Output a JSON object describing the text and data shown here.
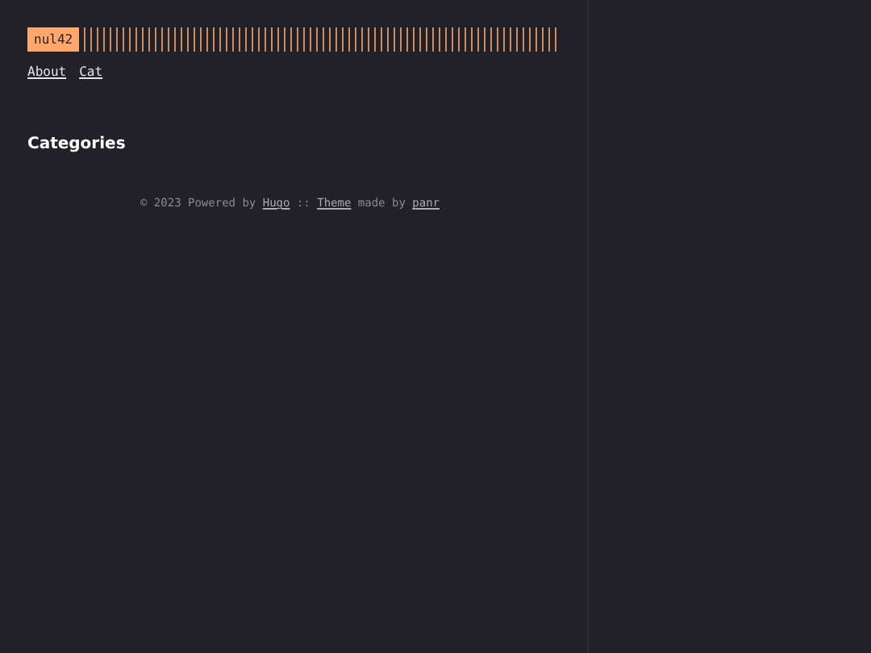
{
  "logo": {
    "text": "nul42"
  },
  "menu": [
    {
      "label": "About"
    },
    {
      "label": "Cat"
    }
  ],
  "heading": "Categories",
  "footer": {
    "copyright": "© 2023 Powered by",
    "hugo_link": "Hugo",
    "separator": "::",
    "theme_link": "Theme",
    "made_by": "made by",
    "author_link": "panr"
  }
}
